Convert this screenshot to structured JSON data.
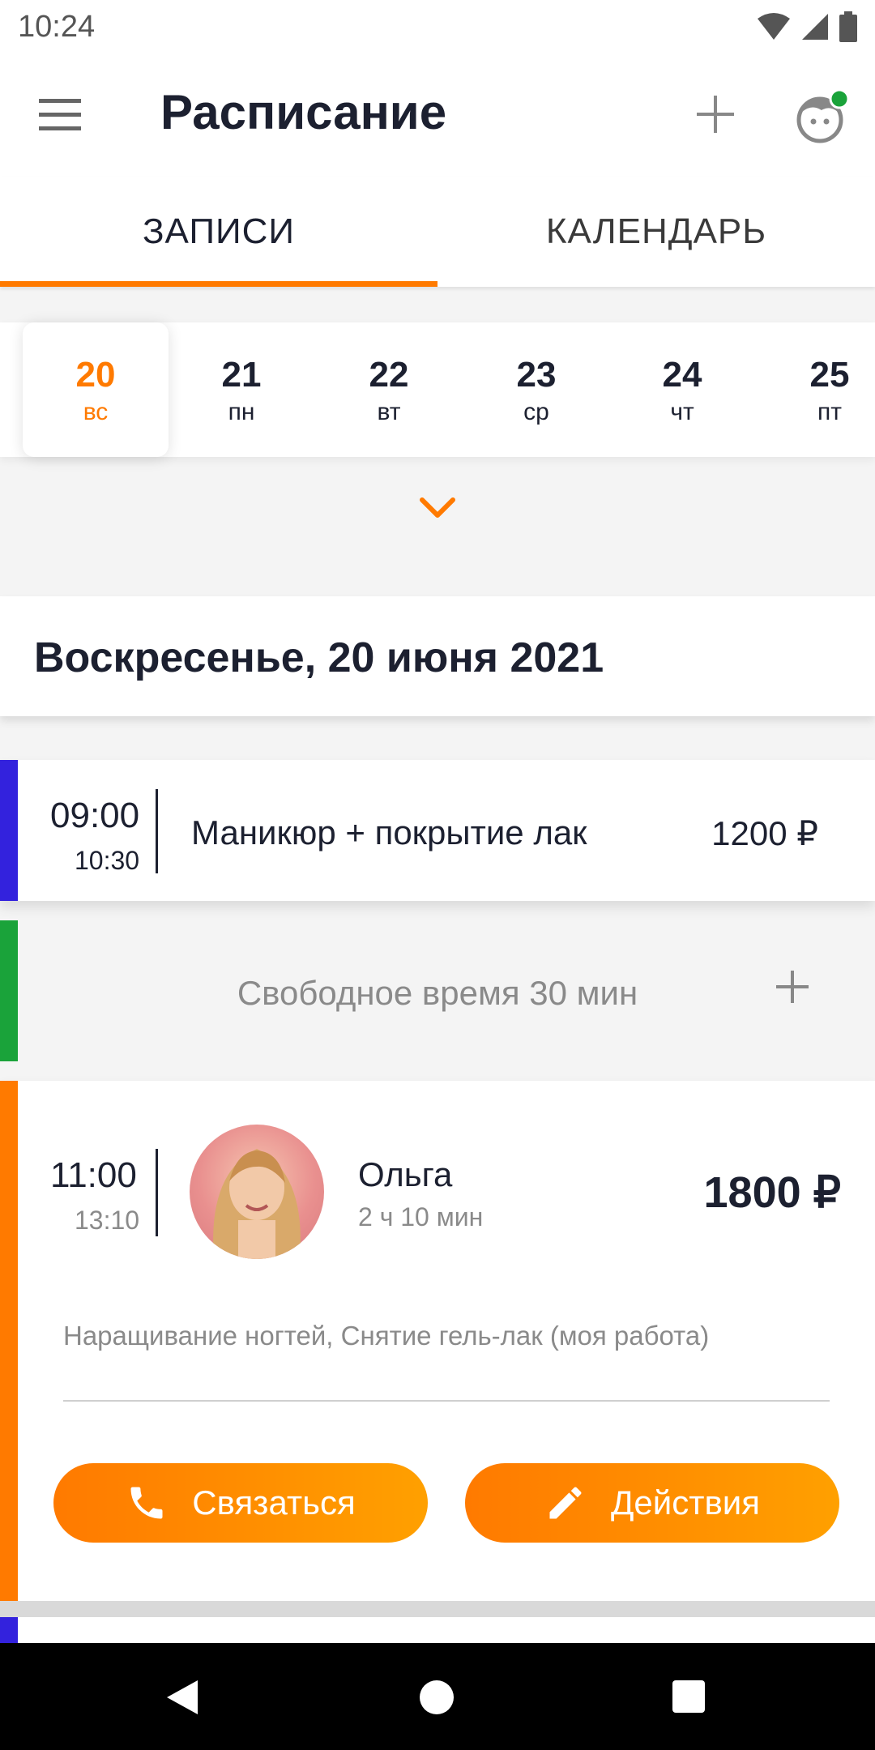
{
  "status_bar": {
    "time": "10:24"
  },
  "app_bar": {
    "title": "Расписание"
  },
  "tabs": [
    {
      "label": "ЗАПИСИ",
      "active": true
    },
    {
      "label": "КАЛЕНДАРЬ",
      "active": false
    }
  ],
  "accent_color": "#ff7a00",
  "dates": [
    {
      "num": "20",
      "dow": "вс",
      "selected": true
    },
    {
      "num": "21",
      "dow": "пн",
      "selected": false
    },
    {
      "num": "22",
      "dow": "вт",
      "selected": false
    },
    {
      "num": "23",
      "dow": "ср",
      "selected": false
    },
    {
      "num": "24",
      "dow": "чт",
      "selected": false
    },
    {
      "num": "25",
      "dow": "пт",
      "selected": false
    }
  ],
  "day_header": {
    "title": "Воскресенье, 20 июня 2021"
  },
  "appointments": [
    {
      "start": "09:00",
      "end": "10:30",
      "service": "Маникюр + покрытие лак",
      "price": "1200 ₽",
      "color": "#3322dd"
    },
    {
      "start": "11:00",
      "end": "13:10",
      "client_name": "Ольга",
      "duration": "2 ч 10 мин",
      "price": "1800 ₽",
      "services": "Наращивание ногтей, Снятие гель-лак (моя работа)",
      "color": "#ff7a00",
      "call_label": "Связаться",
      "actions_label": "Действия"
    }
  ],
  "free_slot": {
    "text": "Свободное время 30 мин",
    "color": "#1aa33a"
  },
  "icons": [
    "wifi-icon",
    "signal-icon",
    "battery-icon",
    "menu-icon",
    "plus-icon",
    "avatar-icon",
    "chevron-down-icon",
    "phone-icon",
    "pencil-icon",
    "back-icon",
    "home-icon",
    "recents-icon"
  ]
}
